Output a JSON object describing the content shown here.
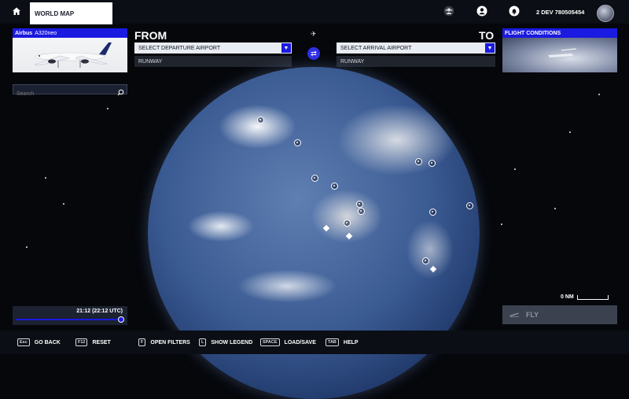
{
  "topbar": {
    "breadcrumb": "WORLD MAP",
    "username": "2 DEV 780505454",
    "icons": [
      "home-icon",
      "community-icon",
      "profile-icon",
      "notifications-icon"
    ]
  },
  "aircraft": {
    "maker": "Airbus",
    "model": "A320neo"
  },
  "route": {
    "from_label": "FROM",
    "to_label": "TO",
    "departure_placeholder": "SELECT DEPARTURE AIRPORT",
    "departure_runway": "RUNWAY",
    "arrival_placeholder": "SELECT ARRIVAL AIRPORT",
    "arrival_runway": "RUNWAY"
  },
  "conditions": {
    "title": "FLIGHT CONDITIONS"
  },
  "search": {
    "placeholder": "Search"
  },
  "time": {
    "display": "21:12 (22:12 UTC)",
    "progress": 0.99
  },
  "map": {
    "scale_label": "0 NM"
  },
  "fly": {
    "label": "FLY"
  },
  "footer": {
    "hints": [
      {
        "key": "Esc",
        "label": "GO BACK"
      },
      {
        "key": "F12",
        "label": "RESET"
      },
      {
        "key": "F",
        "label": "OPEN FILTERS"
      },
      {
        "key": "L",
        "label": "SHOW LEGEND"
      },
      {
        "key": "SPACE",
        "label": "LOAD/SAVE"
      },
      {
        "key": "TAB",
        "label": "HELP"
      }
    ]
  },
  "colors": {
    "accent": "#1a1ae0",
    "panel": "#1c2230",
    "background": "#05070b"
  }
}
